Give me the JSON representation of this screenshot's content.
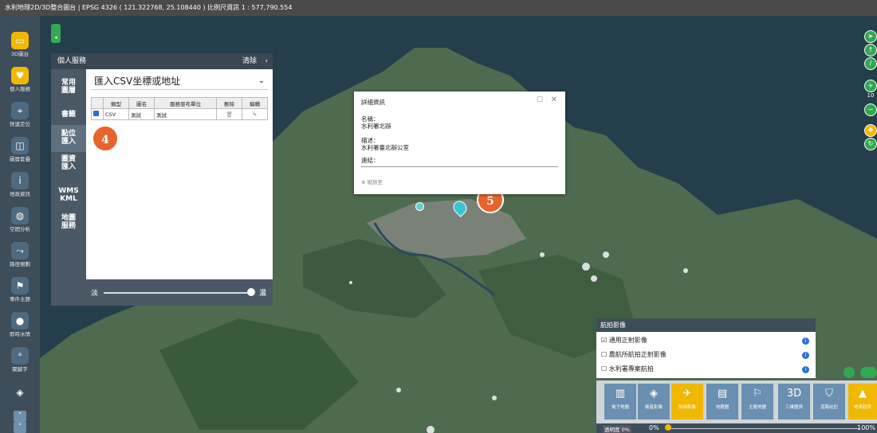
{
  "topbar": {
    "title": "水利地理2D/3D整合圖台 | EPSG 4326 ( 121.322768, 25.108440 ) 比例尺資訊 1 : 577,790.554"
  },
  "leftbar": {
    "items": [
      {
        "label": "3D圖台",
        "icon": "monitor-icon"
      },
      {
        "label": "個人服務",
        "icon": "heart-icon"
      },
      {
        "label": "快速定位",
        "icon": "location-pin-icon"
      },
      {
        "label": "圖層套疊",
        "icon": "layers-icon"
      },
      {
        "label": "地政資訊",
        "icon": "info-icon"
      },
      {
        "label": "空間分析",
        "icon": "globe-icon"
      },
      {
        "label": "路徑規劃",
        "icon": "route-icon"
      },
      {
        "label": "事件主題",
        "icon": "flag-icon"
      },
      {
        "label": "即時水情",
        "icon": "water-drop-icon"
      },
      {
        "label": "關鍵字",
        "icon": "keyword-icon"
      },
      {
        "label": "",
        "icon": "eraser-icon"
      }
    ]
  },
  "panel": {
    "title": "個人服務",
    "clear": "清除",
    "close": "‹",
    "nav": [
      {
        "label": "常用\n圖層"
      },
      {
        "label": "書籤"
      },
      {
        "label": "點位\n匯入"
      },
      {
        "label": "圖資\n匯入"
      },
      {
        "label": "WMS\nKML"
      },
      {
        "label": "地圖\n服務"
      }
    ],
    "select_value": "匯入CSV坐標或地址",
    "table": {
      "headers": [
        "",
        "類型",
        "圖名",
        "服務發布單位",
        "刪除",
        "編輯"
      ],
      "rows": [
        {
          "type": "CSV",
          "name": "測試",
          "unit": "測試"
        }
      ]
    },
    "slider": {
      "left": "淡",
      "right": "濃",
      "value": 1.0
    }
  },
  "badges": {
    "b4": "4",
    "b5": "5"
  },
  "popup": {
    "title": "詳細資訊",
    "name_label": "名稱：",
    "name_value": "水利署北辦",
    "desc_label": "描述：",
    "desc_value": "水利署臺北辦公室",
    "link_label": "連結：",
    "zoom": "⊕ 縮放至"
  },
  "rightbar": {
    "zoom_level": "10"
  },
  "aerial": {
    "title": "航拍影像",
    "rows": [
      {
        "label": "通用正射影像",
        "checked": true
      },
      {
        "label": "農航所航拍正射影像",
        "checked": false
      },
      {
        "label": "水利署專案航拍",
        "checked": false
      }
    ]
  },
  "basemap": {
    "items": [
      {
        "label": "電子地圖",
        "icon": "map-icon"
      },
      {
        "label": "衛星影像",
        "icon": "satellite-icon"
      },
      {
        "label": "航拍影像",
        "icon": "plane-icon",
        "active": true
      },
      {
        "label": "地籍圖",
        "icon": "cadastral-icon"
      },
      {
        "label": "主題地圖",
        "icon": "theme-map-icon"
      },
      {
        "label": "三維圖資",
        "icon": "3d-icon"
      },
      {
        "label": "道路註記",
        "icon": "road-icon"
      },
      {
        "label": "地表起伏",
        "icon": "terrain-icon"
      }
    ],
    "opacity_label": "透明度 0%",
    "opacity_min": "0%",
    "opacity_max": "100%",
    "opacity_value": 0.0
  },
  "colors": {
    "accent": "#f0b800",
    "green": "#33a853",
    "badge": "#e8642c",
    "marker": "#39c4d6"
  }
}
